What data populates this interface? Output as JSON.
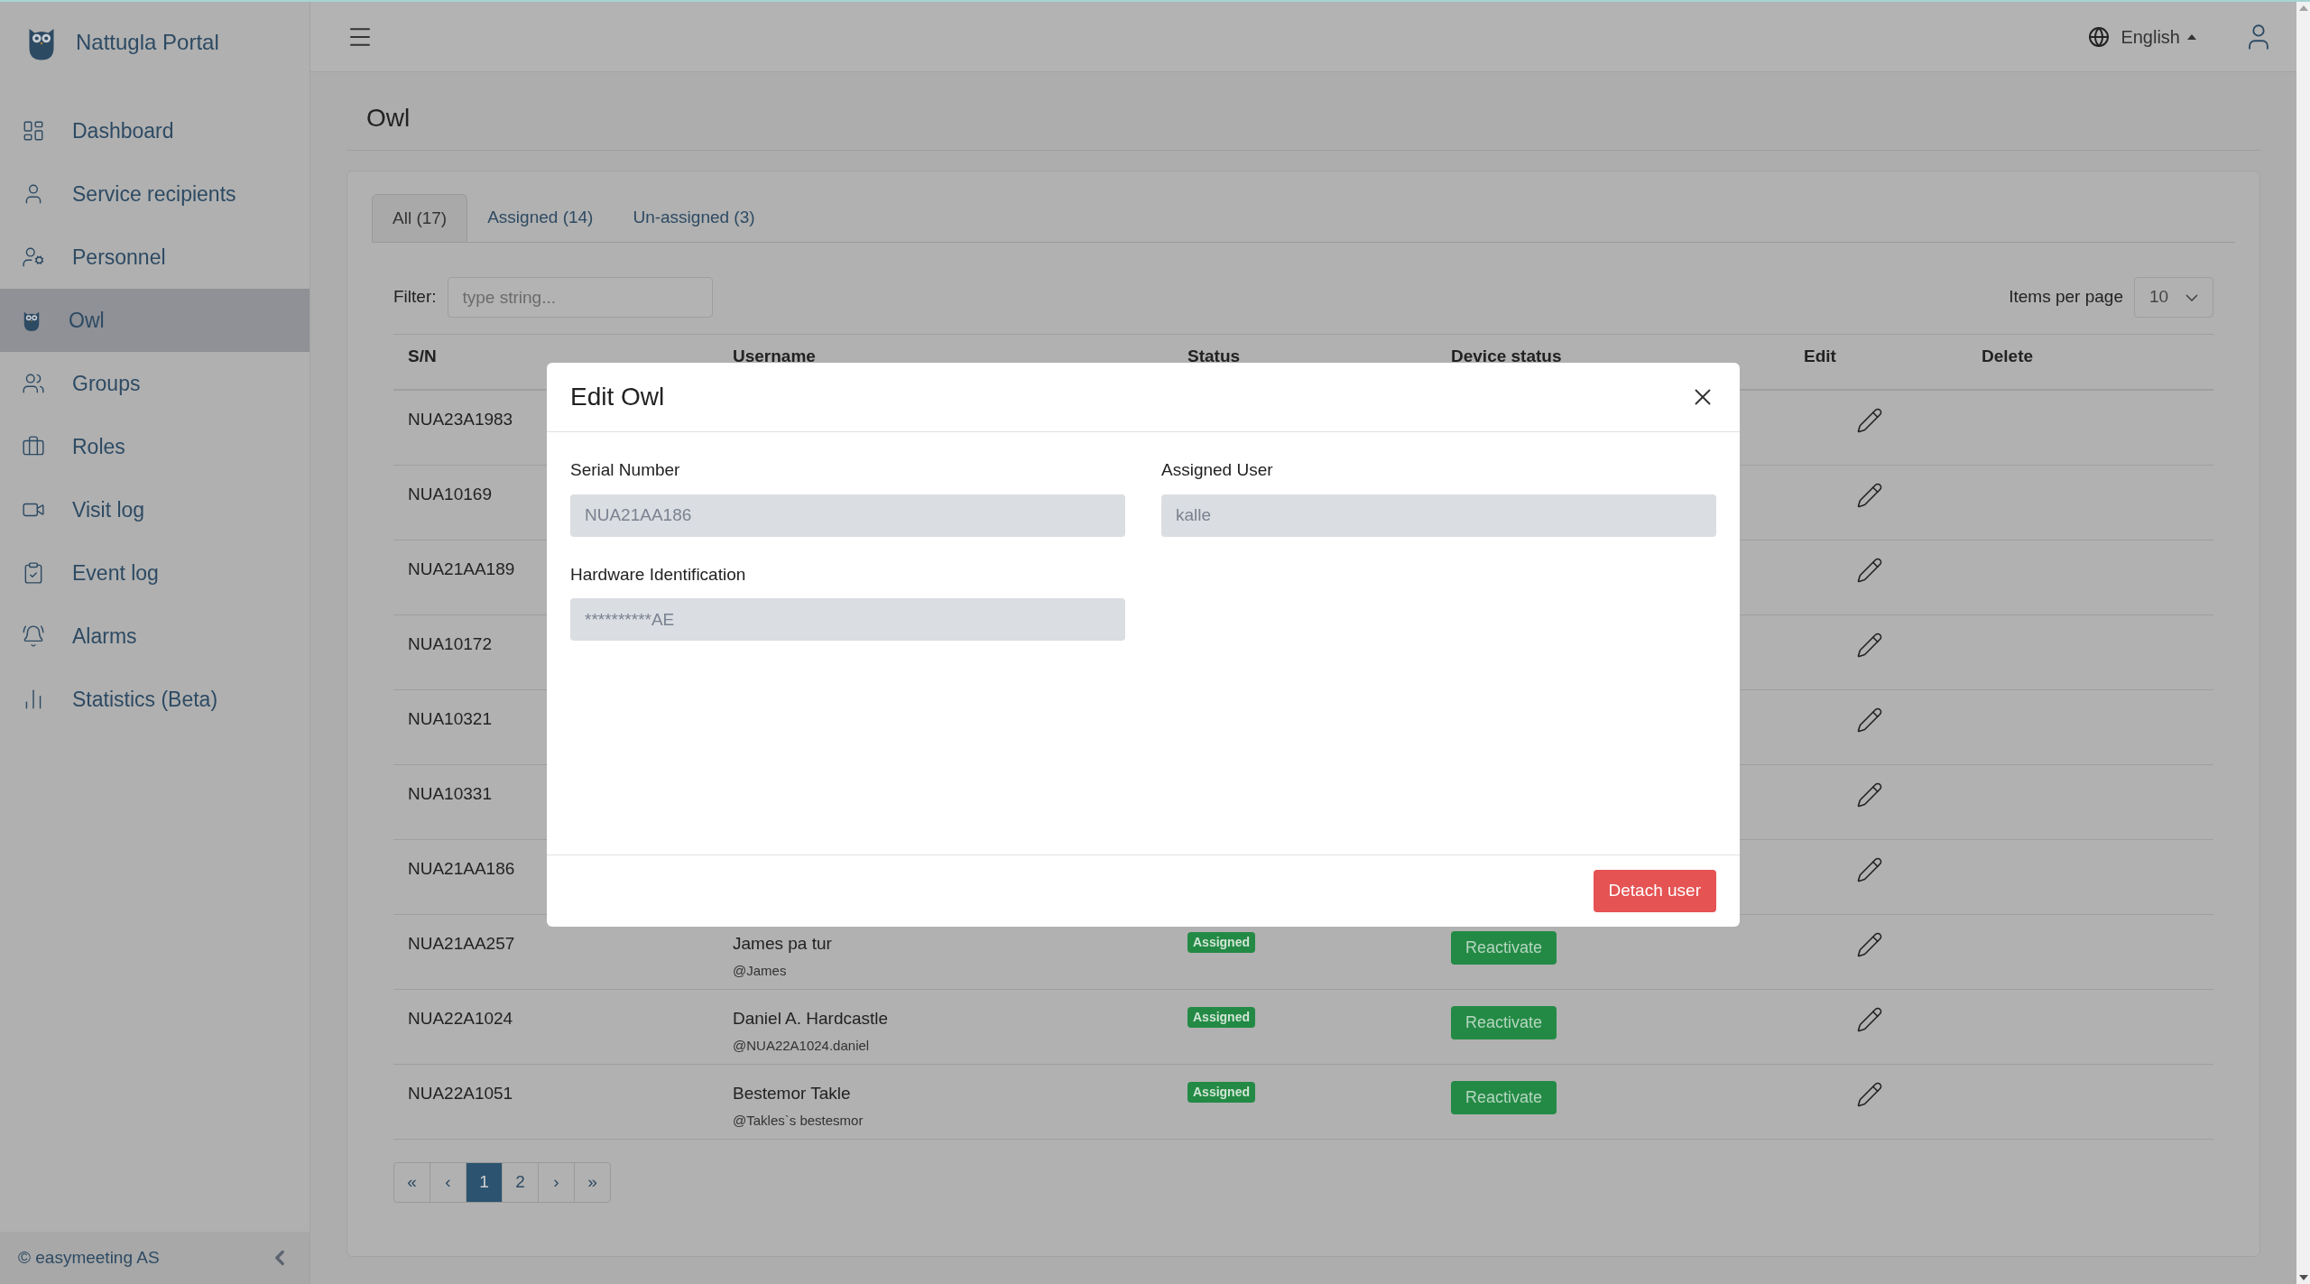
{
  "brand": "Nattugla Portal",
  "sidebar": {
    "items": [
      {
        "label": "Dashboard",
        "selected": false
      },
      {
        "label": "Service recipients",
        "selected": false
      },
      {
        "label": "Personnel",
        "selected": false
      },
      {
        "label": "Owl",
        "selected": true
      },
      {
        "label": "Groups",
        "selected": false
      },
      {
        "label": "Roles",
        "selected": false
      },
      {
        "label": "Visit log",
        "selected": false
      },
      {
        "label": "Event log",
        "selected": false
      },
      {
        "label": "Alarms",
        "selected": false
      },
      {
        "label": "Statistics (Beta)",
        "selected": false
      }
    ],
    "footer": "© easymeeting AS"
  },
  "header": {
    "language": "English"
  },
  "page_title": "Owl",
  "tabs": [
    {
      "label": "All (17)",
      "selected": true
    },
    {
      "label": "Assigned (14)",
      "selected": false
    },
    {
      "label": "Un-assigned (3)",
      "selected": false
    }
  ],
  "filter": {
    "label": "Filter:",
    "placeholder": "type string..."
  },
  "items_per_page": {
    "label": "Items per page",
    "value": "10"
  },
  "table": {
    "columns": [
      "S/N",
      "Username",
      "Status",
      "Device status",
      "Edit",
      "Delete"
    ],
    "rows": [
      {
        "sn": "NUA23A1983"
      },
      {
        "sn": "NUA10169"
      },
      {
        "sn": "NUA21AA189"
      },
      {
        "sn": "NUA10172"
      },
      {
        "sn": "NUA10321"
      },
      {
        "sn": "NUA10331"
      },
      {
        "sn": "NUA21AA186"
      },
      {
        "sn": "NUA21AA257",
        "name": "James pa tur",
        "handle": "@James",
        "status": "Assigned",
        "device_status": "Reactivate"
      },
      {
        "sn": "NUA22A1024",
        "name": "Daniel A. Hardcastle",
        "handle": "@NUA22A1024.daniel",
        "status": "Assigned",
        "device_status": "Reactivate"
      },
      {
        "sn": "NUA22A1051",
        "name": "Bestemor Takle",
        "handle": "@Takles`s bestesmor",
        "status": "Assigned",
        "device_status": "Reactivate"
      }
    ]
  },
  "pagination": [
    {
      "label": "«",
      "selected": false
    },
    {
      "label": "‹",
      "selected": false
    },
    {
      "label": "1",
      "selected": true
    },
    {
      "label": "2",
      "selected": false
    },
    {
      "label": "›",
      "selected": false
    },
    {
      "label": "»",
      "selected": false
    }
  ],
  "modal": {
    "title": "Edit Owl",
    "fields": [
      {
        "label": "Serial Number",
        "value": "NUA21AA186",
        "disabled": true
      },
      {
        "label": "Assigned User",
        "value": "kalle",
        "disabled": true
      },
      {
        "label": "Hardware Identification",
        "value": "**********AE",
        "disabled": true
      }
    ],
    "button": "Detach user"
  }
}
